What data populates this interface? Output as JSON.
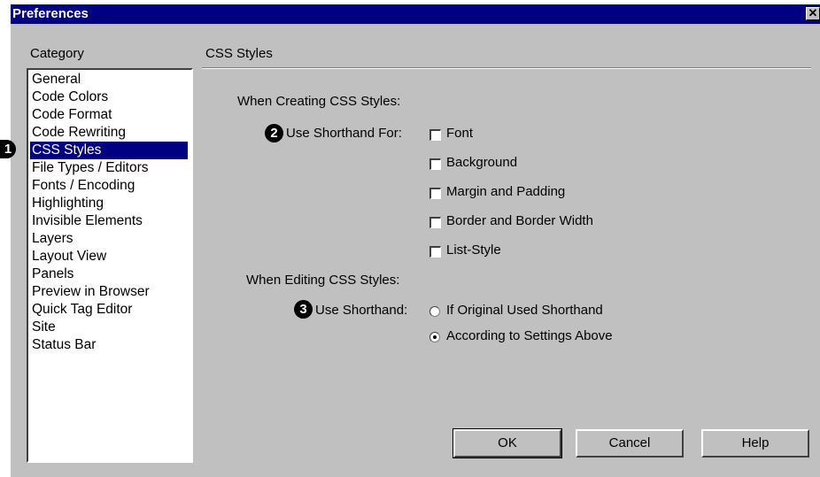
{
  "window": {
    "title": "Preferences",
    "close_glyph": "✕"
  },
  "category": {
    "label": "Category",
    "items": [
      "General",
      "Code Colors",
      "Code Format",
      "Code Rewriting",
      "CSS Styles",
      "File Types / Editors",
      "Fonts / Encoding",
      "Highlighting",
      "Invisible Elements",
      "Layers",
      "Layout View",
      "Panels",
      "Preview in Browser",
      "Quick Tag Editor",
      "Site",
      "Status Bar"
    ],
    "selected": "CSS Styles"
  },
  "callouts": {
    "one": "1",
    "two": "2",
    "three": "3"
  },
  "panel": {
    "title": "CSS Styles",
    "creating_label": "When Creating CSS Styles:",
    "shorthand_for_label": "Use Shorthand For:",
    "options": [
      {
        "label": "Font",
        "checked": false
      },
      {
        "label": "Background",
        "checked": false
      },
      {
        "label": "Margin and Padding",
        "checked": false
      },
      {
        "label": "Border and Border Width",
        "checked": false
      },
      {
        "label": "List-Style",
        "checked": false
      }
    ],
    "editing_label": "When Editing CSS Styles:",
    "use_shorthand_label": "Use Shorthand:",
    "radios": [
      {
        "label": "If Original Used Shorthand",
        "selected": false
      },
      {
        "label": "According to Settings Above",
        "selected": true
      }
    ]
  },
  "buttons": {
    "ok": "OK",
    "cancel": "Cancel",
    "help": "Help"
  }
}
